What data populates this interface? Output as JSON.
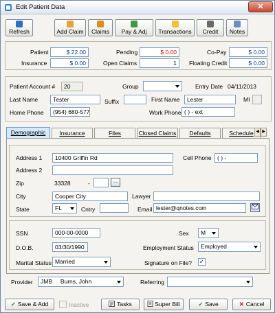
{
  "window": {
    "title": "Edit Patient Data",
    "close_glyph": "✕"
  },
  "toolbar": {
    "refresh": "Refresh",
    "add_claim": "Add Claim",
    "claims": "Claims",
    "pay_adj": "Pay & Adj",
    "transactions": "Transactions",
    "credit": "Credit",
    "notes": "Notes"
  },
  "balances": {
    "patient_label": "Patient",
    "patient_value": "$ 22.00",
    "insurance_label": "Insurance",
    "insurance_value": "$ 0.00",
    "pending_label": "Pending",
    "pending_value": "$ 0.00",
    "open_claims_label": "Open Claims",
    "open_claims_value": "1",
    "copay_label": "Co-Pay",
    "copay_value": "$ 0.00",
    "floating_label": "Floating Credit",
    "floating_value": "$ 0.00"
  },
  "patient": {
    "account_label": "Patient Account #",
    "account_value": "20",
    "group_label": "Group",
    "group_value": "",
    "entry_date_label": "Entry Date",
    "entry_date_value": "04/11/2013",
    "last_name_label": "Last Name",
    "last_name_value": "Tester",
    "suffix_label": "Suffix",
    "suffix_value": "",
    "first_name_label": "First Name",
    "first_name_value": "Lester",
    "mi_label": "MI",
    "mi_value": "",
    "home_phone_label": "Home Phone",
    "home_phone_value": "(954) 680-5776",
    "work_phone_label": "Work Phone",
    "work_phone_value": "(  )   -     ext"
  },
  "tabs": [
    "Demographic",
    "Insurance",
    "Files",
    "Closed Claims",
    "Defaults",
    "Schedule"
  ],
  "tab_scroll": {
    "left": "◀",
    "right": "▶"
  },
  "demographic": {
    "address1_label": "Address 1",
    "address1_value": "10400 Griffin Rd",
    "address2_label": "Address 2",
    "address2_value": "",
    "cell_phone_label": "Cell Phone",
    "cell_phone_value": "(  )   -",
    "zip_label": "Zip",
    "zip_value": "33328",
    "zip_sep": "-",
    "zip_ext": "",
    "zip_lookup": "...",
    "city_label": "City",
    "city_value": "Cooper City",
    "lawyer_label": "Lawyer",
    "lawyer_value": "",
    "state_label": "State",
    "state_value": "FL",
    "country_label": "Cntry",
    "country_value": "",
    "email_label": "Email",
    "email_value": "lester@qnotes.com",
    "ssn_label": "SSN",
    "ssn_value": "000-00-0000",
    "sex_label": "Sex",
    "sex_value": "M",
    "dob_label": "D.O.B.",
    "dob_value": "03/30/1990",
    "employment_label": "Employment Status",
    "employment_value": "Employed",
    "marital_label": "Marital Status",
    "marital_value": "Married",
    "signature_label": "Signature on File?",
    "signature_checked": "✓"
  },
  "provider": {
    "provider_label": "Provider",
    "provider_code": "JMB",
    "provider_name": "Burns, John",
    "referring_label": "Referring",
    "referring_value": ""
  },
  "bottom": {
    "save_add": "Save & Add",
    "save_add_icon": "✓",
    "inactive": "Inactive",
    "tasks": "Tasks",
    "super_bill": "Super Bill",
    "save": "Save",
    "save_icon": "✓",
    "cancel": "Cancel",
    "cancel_icon": "✕"
  },
  "colors": {
    "accent": "#d6e8fb",
    "money_blue": "#0a3c9c",
    "money_red": "#d10000",
    "ok_green": "#1f8a1f",
    "cancel_red": "#c0161b"
  }
}
